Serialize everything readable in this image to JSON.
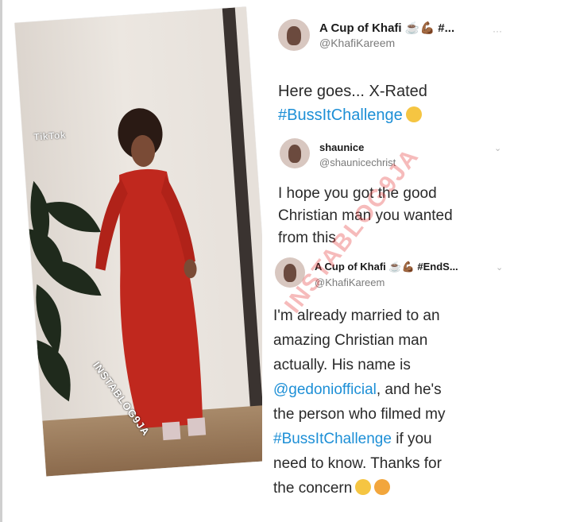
{
  "video": {
    "tiktok_label": "TikTok",
    "watermark": "INSTABLOG9JA"
  },
  "tweet_main": {
    "name": "A Cup of Khafi ☕💪🏾 #...",
    "handle": "@KhafiKareem",
    "more_icon": "dots-icon",
    "line1": "Here goes... X-Rated",
    "hashtag": "#BussItChallenge",
    "emoji": "🤓"
  },
  "reply_1": {
    "name": "shaunice",
    "handle": "@shaunicechrist",
    "lines": [
      "I hope you got the good",
      "Christian man you wanted",
      "from this"
    ]
  },
  "reply_2": {
    "name": "A Cup of Khafi ☕💪🏾 #EndS...",
    "handle": "@KhafiKareem",
    "line1": "I'm already married to an",
    "line2": "amazing Christian man",
    "line3": "actually. His name is",
    "mention": "@gedoniofficial",
    "line4_rest": ", and he's",
    "line5": "the person who filmed my",
    "hashtag": "#BussItChallenge",
    "line6_rest": " if you",
    "line7": "need to know. Thanks for",
    "line8": "the concern",
    "emoji1": "😉",
    "emoji2": "😘"
  },
  "card_watermark": "INSTABLOG9JA",
  "colors": {
    "link": "#1d8fd6",
    "dress": "#c0281e"
  }
}
